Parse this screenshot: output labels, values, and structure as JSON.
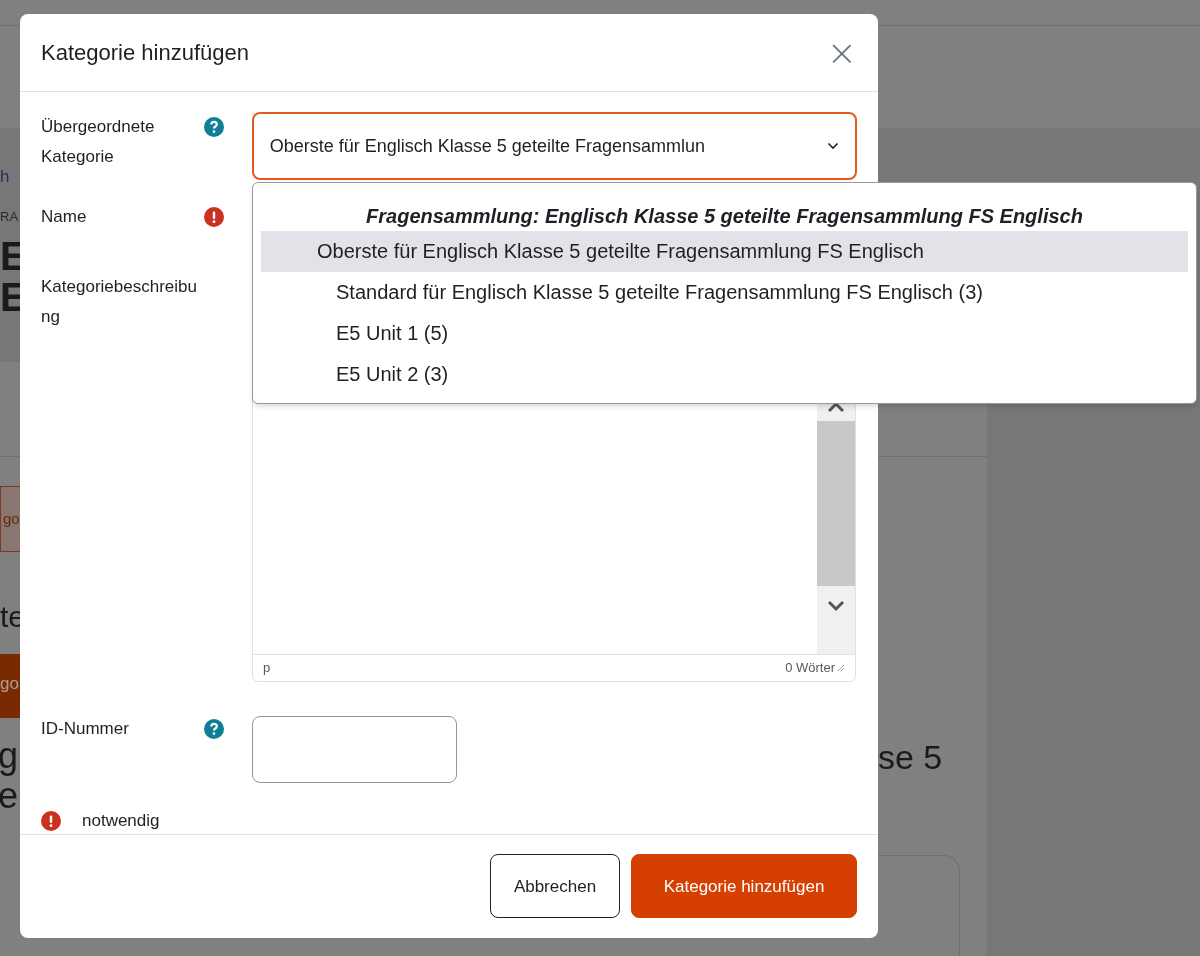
{
  "background_fragments": [
    "h",
    "RA",
    "E",
    "E",
    "go",
    "te",
    "go",
    "g",
    "e",
    "se 5"
  ],
  "dialog": {
    "title": "Kategorie hinzufügen",
    "close_glyph": "×",
    "fields": [
      {
        "kind": "select",
        "label": "Übergeordnete Kategorie",
        "help": true,
        "required": false,
        "value": "Oberste für Englisch Klasse 5 geteilte Fragensammlun",
        "expanded": true
      },
      {
        "kind": "text",
        "label": "Name",
        "help": false,
        "required": true
      },
      {
        "kind": "editor",
        "label": "Kategoriebeschreibung",
        "path": "p",
        "word_count": "0 Wörter"
      },
      {
        "kind": "short",
        "label": "ID-Nummer",
        "help": true,
        "required": false
      }
    ],
    "required_note": "notwendig",
    "buttons": [
      {
        "label": "Abbrechen",
        "kind": "secondary"
      },
      {
        "label": "Kategorie hinzufügen",
        "kind": "primary"
      }
    ]
  },
  "dropdown": {
    "group": "Fragensammlung: Englisch Klasse 5 geteilte Fragensammlung FS Englisch",
    "options": [
      {
        "label": "Oberste für Englisch Klasse 5 geteilte Fragensammlung FS Englisch",
        "selected": true,
        "children": [
          {
            "label": "Standard für Englisch Klasse 5 geteilte Fragensammlung FS Englisch (3)",
            "selected": false
          },
          {
            "label": "E5 Unit 1 (5)",
            "selected": false
          },
          {
            "label": "E5 Unit 2 (3)",
            "selected": false
          }
        ]
      }
    ]
  }
}
